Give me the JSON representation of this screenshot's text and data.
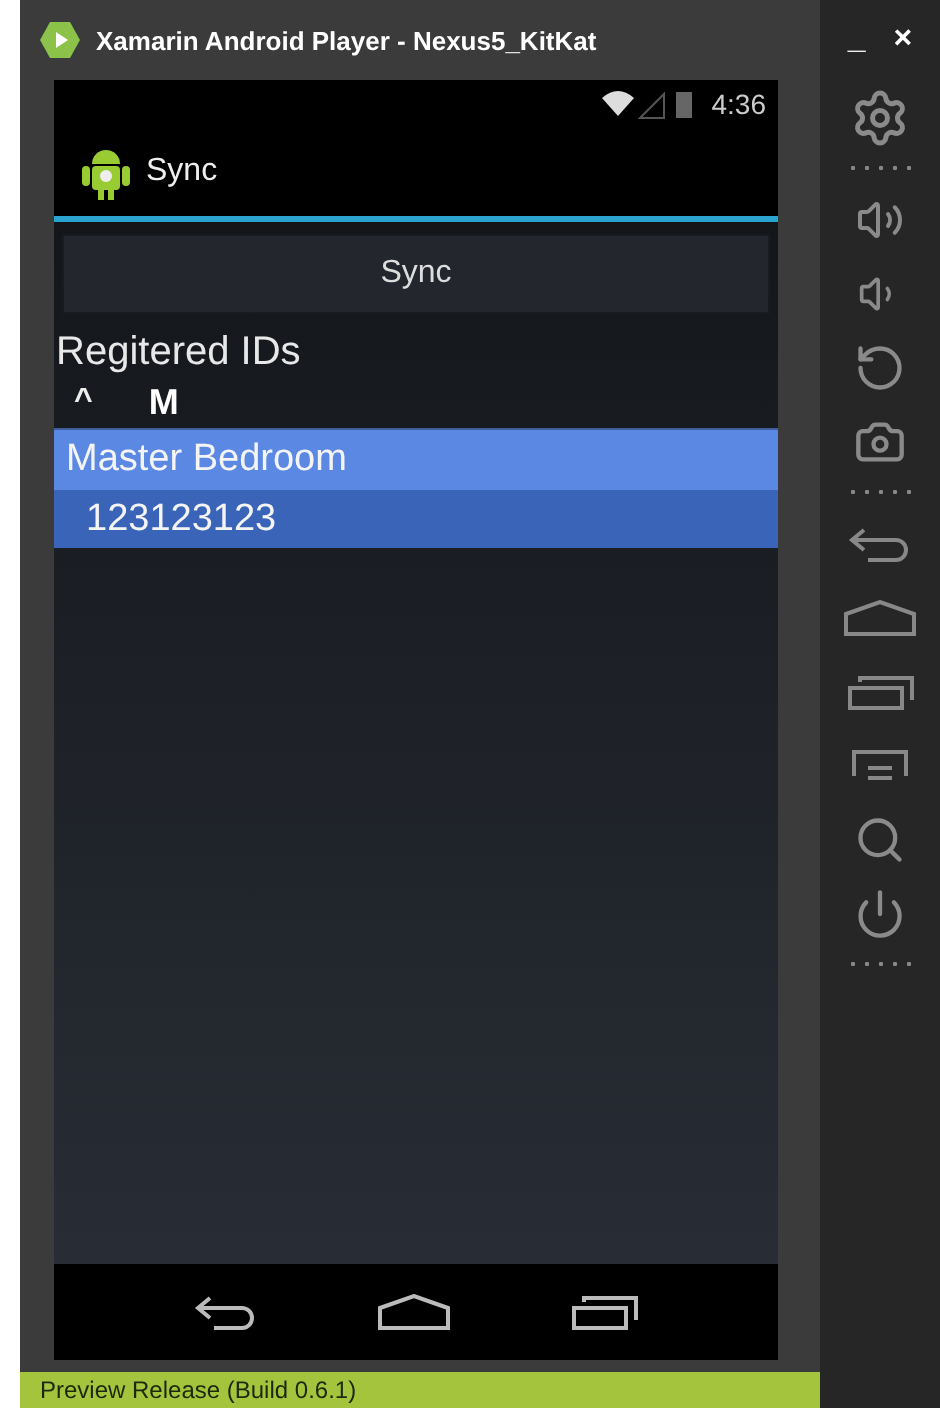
{
  "window": {
    "title": "Xamarin Android Player - Nexus5_KitKat",
    "minimize": "_",
    "close": "×"
  },
  "status_bar": {
    "time": "4:36"
  },
  "action_bar": {
    "title": "Sync"
  },
  "sync_button": {
    "label": "Sync"
  },
  "section_title": "Regitered IDs",
  "groups": [
    {
      "toggle": "^",
      "header": "M",
      "expanded": true,
      "items": [
        {
          "name": "Master Bedroom",
          "id": "123123123",
          "selected": true
        }
      ]
    }
  ],
  "footer": {
    "text": "Preview Release (Build 0.6.1)"
  }
}
